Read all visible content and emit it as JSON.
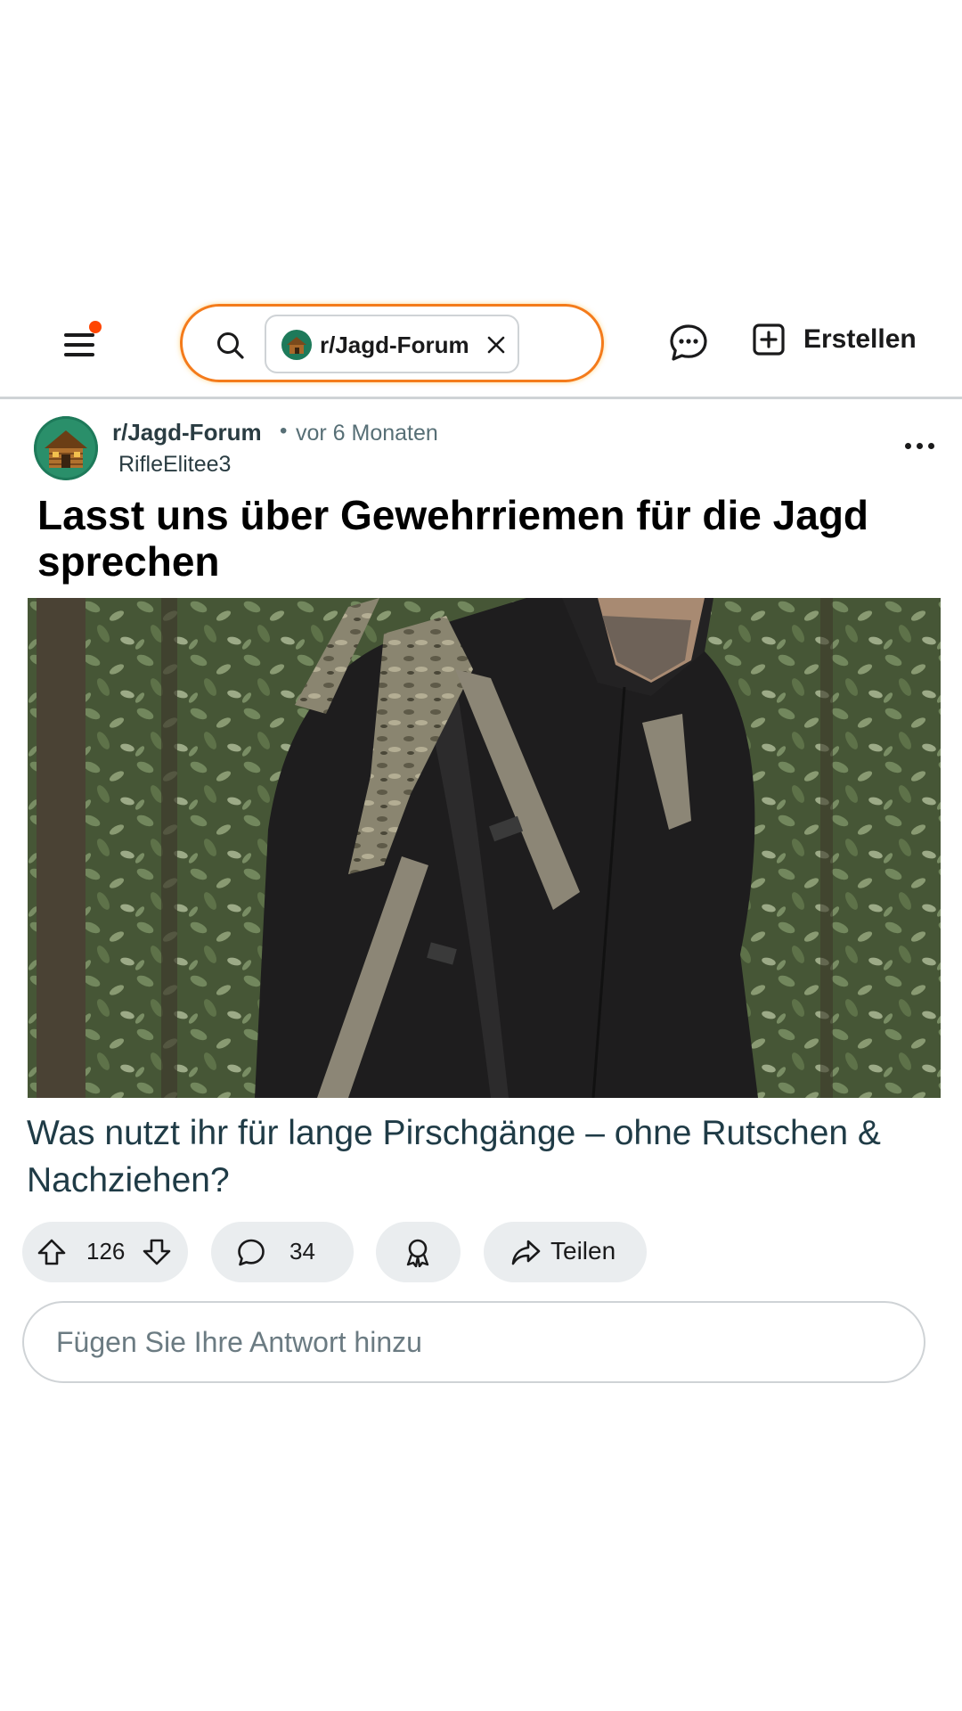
{
  "header": {
    "search_chip_label": "r/Jagd-Forum",
    "create_label": "Erstellen",
    "notification_dot_color": "#ff4500",
    "search_border_color": "#f47b1b"
  },
  "post": {
    "subreddit": "r/Jagd-Forum",
    "separator": "•",
    "timestamp": "vor 6 Monaten",
    "author": "RifleElitee3",
    "title": "Lasst uns über Gewehrriemen für die Jagd sprechen",
    "body": "Was nutzt ihr für lange Pirschgänge – ohne Rutschen & Nachziehen?"
  },
  "actions": {
    "upvotes": "126",
    "comments": "34",
    "share_label": "Teilen"
  },
  "reply": {
    "placeholder": "Fügen Sie Ihre Antwort hinzu"
  }
}
